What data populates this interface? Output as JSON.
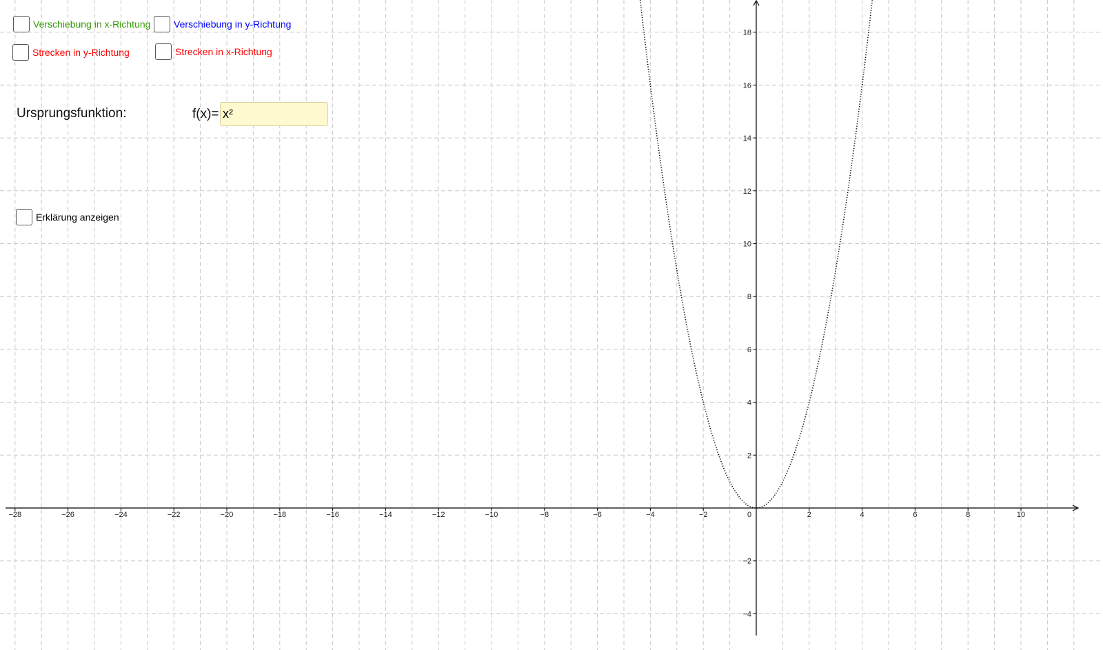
{
  "checkboxes": {
    "shift_x": {
      "label": "Verschiebung in x-Richtung",
      "color": "#339900",
      "checked": false
    },
    "shift_y": {
      "label": "Verschiebung in y-Richtung",
      "color": "#0000ff",
      "checked": false
    },
    "stretch_y": {
      "label": "Strecken in y-Richtung",
      "color": "#ff0000",
      "checked": false
    },
    "stretch_x": {
      "label": "Strecken in x-Richtung",
      "color": "#ff0000",
      "checked": false
    },
    "explanation": {
      "label": "Erklärung anzeigen",
      "color": "#000000",
      "checked": false
    }
  },
  "function_panel": {
    "heading": "Ursprungsfunktion:",
    "input_label": "f(x)=",
    "input_value": "x²"
  },
  "chart_data": {
    "type": "line",
    "function": "x^2",
    "line_style": "dotted",
    "xlim": [
      -28.5,
      12
    ],
    "ylim": [
      -4.7,
      19.2
    ],
    "x_ticks": [
      -28,
      -26,
      -24,
      -22,
      -20,
      -18,
      -16,
      -14,
      -12,
      -10,
      -8,
      -6,
      -4,
      -2,
      0,
      2,
      4,
      6,
      8,
      10
    ],
    "y_ticks": [
      -4,
      -2,
      2,
      4,
      6,
      8,
      10,
      12,
      14,
      16,
      18
    ],
    "grid": true,
    "grid_style": "dashed",
    "colors": {
      "grid": "#c8c8c8",
      "axis": "#000000",
      "curve": "#000000"
    }
  }
}
